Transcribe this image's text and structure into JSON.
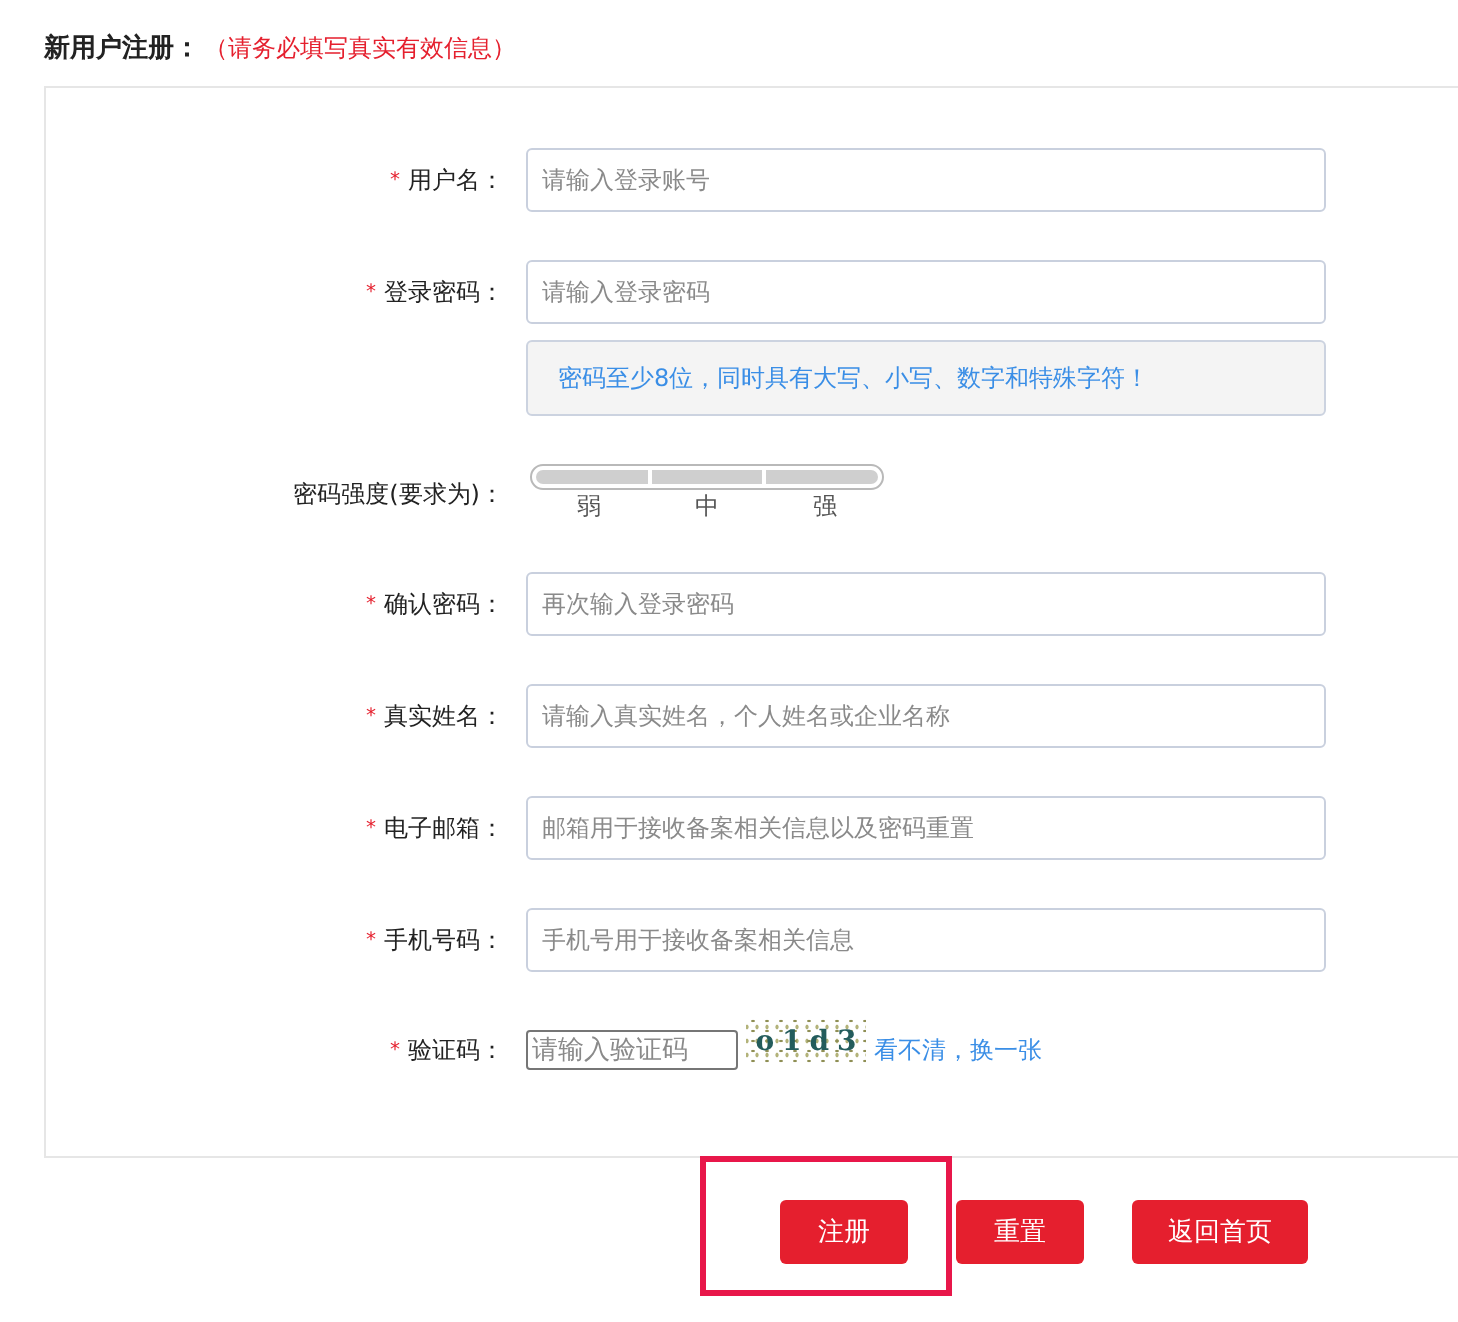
{
  "header": {
    "title": "新用户注册：",
    "note": "（请务必填写真实有效信息）"
  },
  "form": {
    "fields": [
      {
        "kind": "text",
        "required_mark": "*",
        "label": "用户名：",
        "placeholder": "请输入登录账号"
      },
      {
        "kind": "text",
        "required_mark": "*",
        "label": "登录密码：",
        "placeholder": "请输入登录密码",
        "hint": "密码至少8位，同时具有大写、小写、数字和特殊字符！"
      },
      {
        "kind": "strength",
        "label": "密码强度(要求为)：",
        "steps": [
          "弱",
          "中",
          "强"
        ]
      },
      {
        "kind": "text",
        "required_mark": "*",
        "label": "确认密码：",
        "placeholder": "再次输入登录密码"
      },
      {
        "kind": "text",
        "required_mark": "*",
        "label": "真实姓名：",
        "placeholder": "请输入真实姓名，个人姓名或企业名称"
      },
      {
        "kind": "text",
        "required_mark": "*",
        "label": "电子邮箱：",
        "placeholder": "邮箱用于接收备案相关信息以及密码重置"
      },
      {
        "kind": "text",
        "required_mark": "*",
        "label": "手机号码：",
        "placeholder": "手机号用于接收备案相关信息"
      },
      {
        "kind": "captcha",
        "required_mark": "*",
        "label": "验证码：",
        "placeholder": "请输入验证码",
        "captcha": "o1d3",
        "link": "看不清，换一张"
      }
    ]
  },
  "buttons": [
    {
      "label": "注册",
      "highlighted": true
    },
    {
      "label": "重置",
      "highlighted": false
    },
    {
      "label": "返回首页",
      "highlighted": false
    }
  ]
}
